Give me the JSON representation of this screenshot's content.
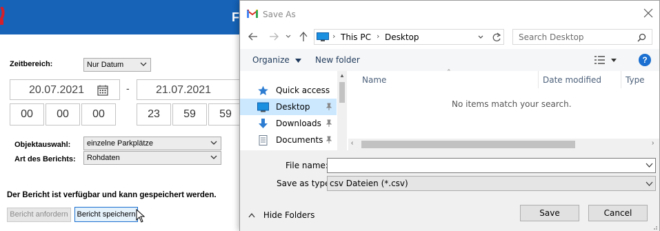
{
  "app": {
    "title": "F",
    "colors": {
      "header_bg": "#1663b8",
      "focus_border": "#1a6fd0"
    },
    "time_range": {
      "label": "Zeitbereich:",
      "mode": "Nur Datum",
      "start_date": "20.07.2021",
      "end_date": "21.07.2021",
      "separator": "-",
      "start_time": [
        "00",
        "00",
        "00"
      ],
      "end_time": [
        "23",
        "59",
        "59"
      ]
    },
    "object_selection": {
      "label": "Objektauswahl:",
      "value": "einzelne Parkplätze"
    },
    "report_type": {
      "label": "Art des Berichts:",
      "value": "Rohdaten"
    },
    "status_message": "Der Bericht ist verfügbar und kann gespeichert werden.",
    "buttons": {
      "request": "Bericht anfordern",
      "save": "Bericht speichern"
    }
  },
  "dialog": {
    "title": "Save As",
    "address": {
      "root": "This PC",
      "folder": "Desktop"
    },
    "search_placeholder": "Search Desktop",
    "toolbar": {
      "organize": "Organize",
      "new_folder": "New folder",
      "help": "?"
    },
    "nav_items": [
      {
        "label": "Quick access",
        "icon": "star-icon"
      },
      {
        "label": "Desktop",
        "icon": "desktop-folder-icon",
        "selected": true,
        "pinned": true
      },
      {
        "label": "Downloads",
        "icon": "download-arrow-icon",
        "pinned": true
      },
      {
        "label": "Documents",
        "icon": "documents-icon",
        "pinned": true
      }
    ],
    "columns": [
      "Name",
      "Date modified",
      "Type"
    ],
    "empty_message": "No items match your search.",
    "file_name": {
      "label": "File name:",
      "value": ""
    },
    "save_type": {
      "label": "Save as type:",
      "value": "csv Dateien (*.csv)"
    },
    "hide_folders": "Hide Folders",
    "save_button": "Save",
    "cancel_button": "Cancel"
  }
}
